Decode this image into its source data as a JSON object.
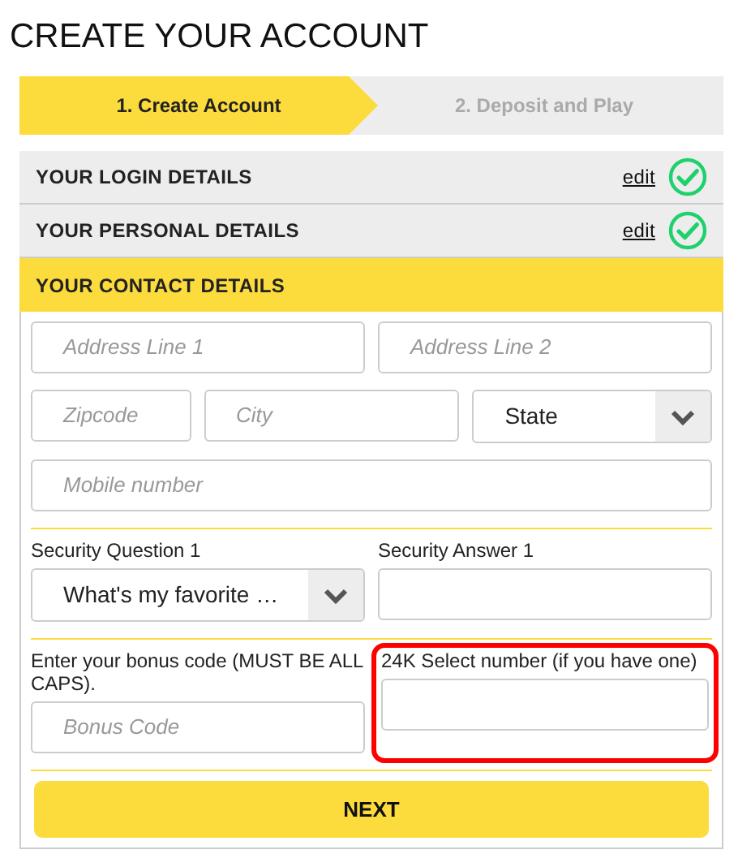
{
  "title": "CREATE YOUR ACCOUNT",
  "steps": [
    {
      "label": "1. Create Account",
      "selected": true
    },
    {
      "label": "2. Deposit and Play",
      "selected": false
    }
  ],
  "sections": [
    {
      "title": "YOUR LOGIN DETAILS",
      "selected": false,
      "completed": true,
      "link": "edit"
    },
    {
      "title": "YOUR PERSONAL DETAILS",
      "selected": false,
      "completed": true,
      "link": "edit"
    },
    {
      "title": "YOUR CONTACT DETAILS",
      "selected": true,
      "completed": false
    }
  ],
  "form_rows": [
    [
      {
        "kind": "input",
        "placeholder": "Address Line 1"
      },
      {
        "kind": "input",
        "placeholder": "Address Line 2"
      }
    ],
    [
      {
        "kind": "input",
        "placeholder": "Zipcode"
      },
      {
        "kind": "input",
        "placeholder": "City"
      },
      {
        "kind": "select",
        "value": "State"
      }
    ],
    [
      {
        "kind": "input",
        "placeholder": "Mobile number"
      }
    ],
    [
      {
        "kind": "select",
        "label": "Security Question 1",
        "value": "What's my favorite …"
      },
      {
        "kind": "input",
        "label": "Security Answer 1"
      }
    ],
    [
      {
        "kind": "input",
        "label": "Enter your bonus code (MUST BE ALL CAPS).",
        "placeholder": "Bonus Code"
      },
      {
        "kind": "input",
        "label": "24K Select number (if you have one)",
        "highlighted": true
      }
    ]
  ],
  "submit": "NEXT"
}
